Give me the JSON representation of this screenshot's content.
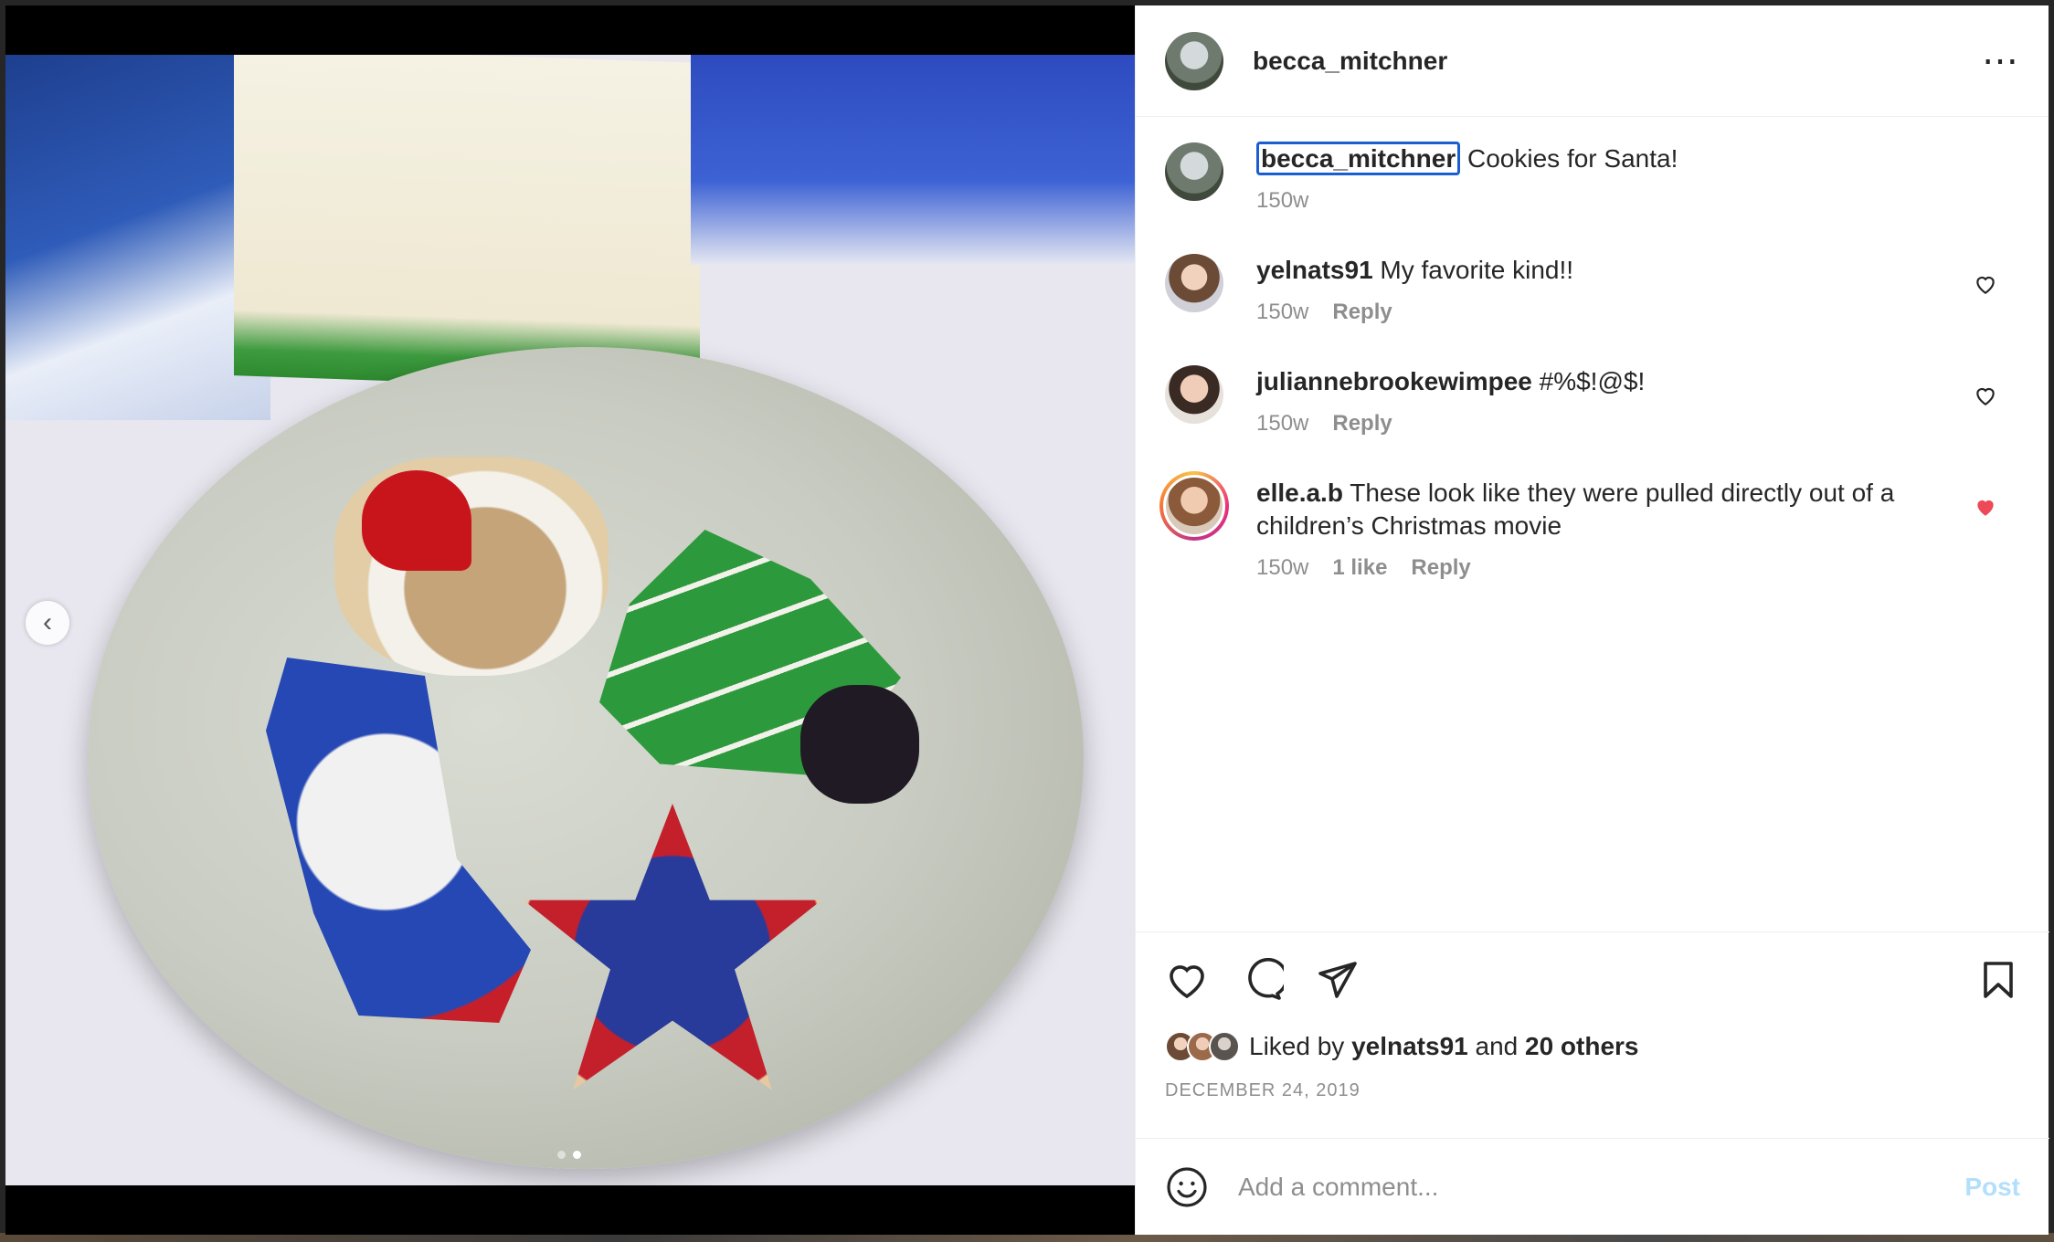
{
  "post": {
    "username": "becca_mitchner",
    "caption": "Cookies for Santa!",
    "caption_age": "150w"
  },
  "comments": [
    {
      "username": "yelnats91",
      "text": "My favorite kind!!",
      "age": "150w",
      "likes": "",
      "reply": "Reply",
      "liked": false
    },
    {
      "username": "juliannebrookewimpee",
      "text": "#%$!@$!",
      "age": "150w",
      "likes": "",
      "reply": "Reply",
      "liked": false
    },
    {
      "username": "elle.a.b",
      "text": "These look like they were pulled directly out of a children’s Christmas movie",
      "age": "150w",
      "likes": "1 like",
      "reply": "Reply",
      "liked": true
    }
  ],
  "likes": {
    "prefix": "Liked by",
    "first_user": "yelnats91",
    "conjunction": "and",
    "others": "20 others"
  },
  "date": "DECEMBER 24, 2019",
  "add_comment": {
    "placeholder": "Add a comment...",
    "post_label": "Post"
  },
  "carousel": {
    "total": 2,
    "active": 2
  },
  "icons": {
    "more": "more-horizontal-icon",
    "like": "heart-icon",
    "comment": "comment-bubble-icon",
    "share": "paper-plane-icon",
    "save": "bookmark-icon",
    "emoji": "smiley-icon",
    "prev": "chevron-left-icon"
  },
  "colors": {
    "liked_heart": "#ed4956",
    "link_focus": "#1a5ed0",
    "post_disabled": "#b2dffc",
    "secondary_text": "#8e8e8e"
  }
}
